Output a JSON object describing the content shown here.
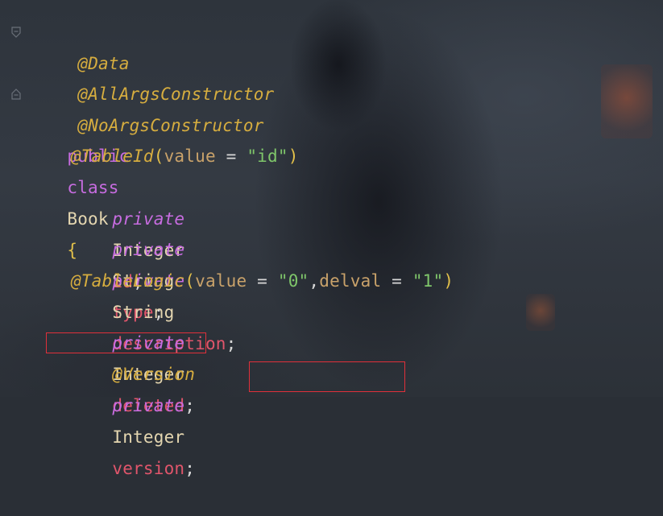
{
  "editor": {
    "lines": {
      "l1": {
        "anno": "@Data"
      },
      "l2": {
        "anno": "@AllArgsConstructor"
      },
      "l3": {
        "anno": "@NoArgsConstructor"
      },
      "l4": {
        "kw_public": "public",
        "kw_class": "class",
        "name": "Book",
        "brace": "{"
      },
      "l5": {
        "anno": "@TableId",
        "open": "(",
        "param": "value",
        "eq": " = ",
        "str": "\"id\"",
        "close": ")"
      },
      "l6": {
        "kw": "private",
        "type": "Integer",
        "field": "id",
        "semi": ";"
      },
      "l7": {
        "kw": "private",
        "type": "String",
        "field": "type",
        "semi": ";"
      },
      "l8": {
        "kw": "private",
        "type": "String",
        "field": "description",
        "semi": ";"
      },
      "l9": {
        "anno": "@TableLogic",
        "open": "(",
        "param1": "value",
        "eq1": " = ",
        "str1": "\"0\"",
        "comma": ",",
        "param2": "delval",
        "eq2": " = ",
        "str2": "\"1\"",
        "close": ")"
      },
      "l10": {
        "kw": "private",
        "type": "Integer",
        "field": "deleted",
        "semi": ";"
      },
      "l11": {
        "anno": "@Version"
      },
      "l12": {
        "kw": "private",
        "type": "Integer",
        "field": "version",
        "semi": ";"
      }
    },
    "highlight_color": "#e0303a"
  }
}
